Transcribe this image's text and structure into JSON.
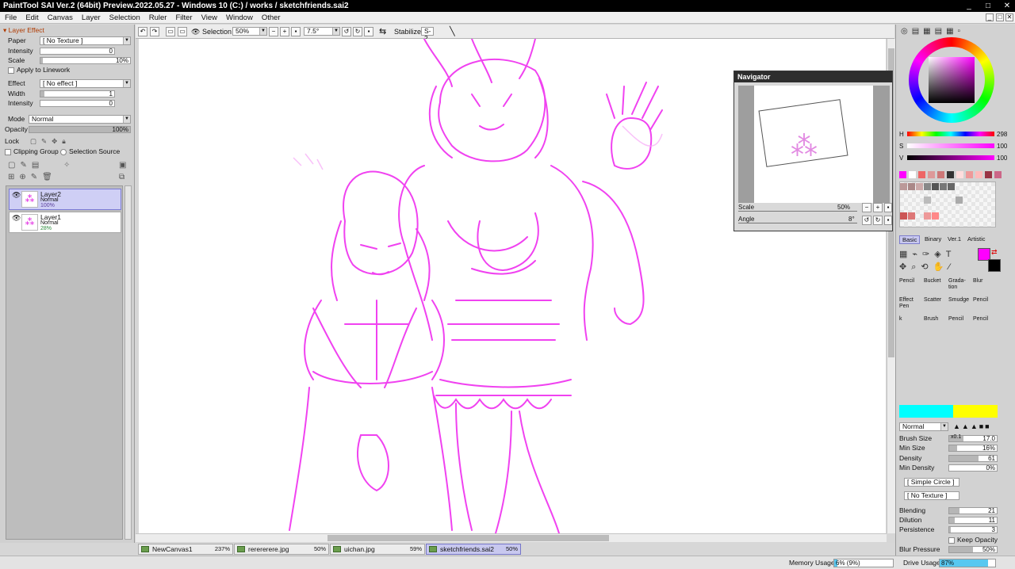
{
  "window": {
    "title": "PaintTool SAI Ver.2 (64bit) Preview.2022.05.27 - Windows 10 (C:) / works / sketchfriends.sai2",
    "minimize": "_",
    "maximize": "□",
    "close": "✕"
  },
  "menu": {
    "items": [
      "File",
      "Edit",
      "Canvas",
      "Layer",
      "Selection",
      "Ruler",
      "Filter",
      "View",
      "Window",
      "Other"
    ],
    "mdi": [
      "_",
      "□",
      "✕"
    ]
  },
  "layer_effect": {
    "header": "Layer Effect",
    "paper_label": "Paper",
    "paper_value": "[ No Texture ]",
    "intensity_label": "Intensity",
    "intensity_value": "0",
    "scale_label": "Scale",
    "scale_value": "10%",
    "apply_linework": "Apply to Linework",
    "effect_label": "Effect",
    "effect_value": "[ No effect ]",
    "width_label": "Width",
    "width_value": "1",
    "intensity2_label": "Intensity",
    "intensity2_value": "0"
  },
  "layer_props": {
    "mode_label": "Mode",
    "mode_value": "Normal",
    "opacity_label": "Opacity",
    "opacity_value": "100%",
    "lock_label": "Lock",
    "clipping_group": "Clipping Group",
    "selection_source": "Selection Source"
  },
  "layers": [
    {
      "name": "Layer2",
      "mode": "Normal",
      "opacity": "100%",
      "selected": true
    },
    {
      "name": "Layer1",
      "mode": "Normal",
      "opacity": "28%",
      "selected": false
    }
  ],
  "toolbar": {
    "selection_label": "Selection",
    "zoom": "50%",
    "angle": "7.5°",
    "stabilizer_label": "Stabilizer",
    "stabilizer_value": "S-2"
  },
  "navigator": {
    "title": "Navigator",
    "scale_label": "Scale",
    "scale_value": "50%",
    "angle_label": "Angle",
    "angle_value": "8°"
  },
  "color": {
    "h_label": "H",
    "h_value": "298",
    "s_label": "S",
    "s_value": "100",
    "v_label": "V",
    "v_value": "100",
    "primary": "#ff00ff",
    "secondary": "#000000"
  },
  "tool_tabs": [
    "Basic",
    "Binary",
    "Ver.1",
    "Artistic"
  ],
  "tools": [
    {
      "name": "Pencil"
    },
    {
      "name": "Bucket"
    },
    {
      "name": "Grada-tion"
    },
    {
      "name": "Blur"
    },
    {
      "name": "Effect Pen"
    },
    {
      "name": "Scatter"
    },
    {
      "name": "Smudge"
    },
    {
      "name": "Pencil"
    },
    {
      "name": "k"
    },
    {
      "name": "Brush"
    },
    {
      "name": "Pencil"
    },
    {
      "name": "Pencil"
    }
  ],
  "brush": {
    "blend_mode": "Normal",
    "size_label": "Brush Size",
    "size_mult": "x0.1",
    "size_value": "17.0",
    "min_size_label": "Min Size",
    "min_size_value": "16%",
    "density_label": "Density",
    "density_value": "61",
    "min_density_label": "Min Density",
    "min_density_value": "0%",
    "shape": "[ Simple Circle ]",
    "texture": "[ No Texture ]",
    "blending_label": "Blending",
    "blending_value": "21",
    "dilution_label": "Dilution",
    "dilution_value": "11",
    "persistence_label": "Persistence",
    "persistence_value": "3",
    "keep_opacity": "Keep Opacity",
    "blur_pressure_label": "Blur Pressure",
    "blur_pressure_value": "50%"
  },
  "tabs": [
    {
      "name": "NewCanvas1",
      "zoom": "237%"
    },
    {
      "name": "rerererere.jpg",
      "zoom": "50%"
    },
    {
      "name": "uichan.jpg",
      "zoom": "59%"
    },
    {
      "name": "sketchfriends.sai2",
      "zoom": "50%",
      "active": true
    }
  ],
  "status": {
    "memory_label": "Memory Usage",
    "memory_value": "6% (9%)",
    "memory_fraction": 0.06,
    "drive_label": "Drive Usage",
    "drive_value": "87%",
    "drive_fraction": 0.87
  }
}
